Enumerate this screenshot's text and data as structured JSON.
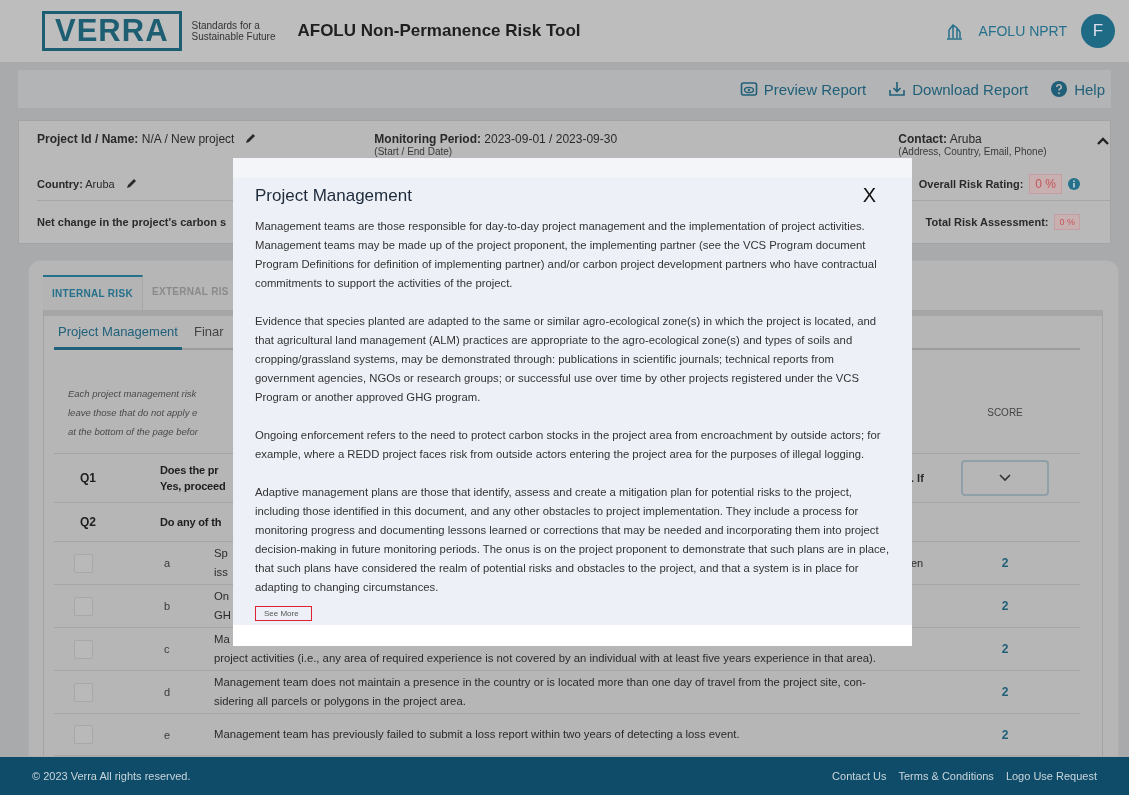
{
  "header": {
    "logo": {
      "wordmark": "VERRA",
      "tagline": [
        "Standards for a",
        "Sustainable Future"
      ]
    },
    "title": "AFOLU Non-Permanence Risk Tool",
    "app_label": "AFOLU NPRT",
    "avatar": "F"
  },
  "toolbar": [
    {
      "kind": "preview",
      "label": "Preview Report"
    },
    {
      "kind": "download",
      "label": "Download Report"
    },
    {
      "kind": "help",
      "label": "Help"
    }
  ],
  "project_info": {
    "project": {
      "label": "Project Id / Name:",
      "value": "N/A / New project",
      "editable": true
    },
    "period": {
      "label": "Monitoring Period:",
      "value": "2023-09-01 / 2023-09-30",
      "hint": "(Start / End Date)"
    },
    "contact": {
      "label": "Contact:",
      "value": "Aruba",
      "hint": "(Address, Country, Email, Phone)"
    },
    "expanded": true,
    "country": {
      "label": "Country:",
      "value": "Aruba",
      "editable": true
    },
    "overall_risk": {
      "label": "Overall Risk Rating:",
      "value": "0 %"
    },
    "net_change": {
      "label": "Net change in the project's carbon s"
    },
    "total_risk": {
      "label": "Total Risk Assessment:",
      "value": "0 %"
    }
  },
  "tabs": [
    {
      "label": "INTERNAL RISK",
      "selected": true
    },
    {
      "label": "EXTERNAL RIS",
      "selected": false
    }
  ],
  "subtabs": [
    {
      "label": "Project Management",
      "selected": true
    },
    {
      "label": "Finar",
      "selected": false
    }
  ],
  "intro_lines": [
    "Each project management risk",
    "leave those that do not apply e",
    "at the bottom of the page befor"
  ],
  "score_header": "SCORE",
  "questions": [
    {
      "kind": "dropdown",
      "number": "Q1",
      "fragments": [
        "Does the pr",
        "Yes, proceed"
      ],
      "tail": ". If"
    },
    {
      "kind": "plain",
      "number": "Q2",
      "fragments": [
        "Do any of th"
      ]
    }
  ],
  "items": [
    {
      "checked": false,
      "letter": "a",
      "fragments": [
        "Sp",
        "iss"
      ],
      "tail": "en",
      "score": "2"
    },
    {
      "checked": false,
      "letter": "b",
      "fragments": [
        "On",
        "GH"
      ],
      "score": "2"
    },
    {
      "checked": false,
      "letter": "c",
      "fragments": [
        "Ma",
        "project activities (i.e., any area of required experience is not covered by an individual with at least five years experience in that area)."
      ],
      "score": "2"
    },
    {
      "checked": false,
      "letter": "d",
      "lines": [
        "Management team does not maintain a presence in the country or is located more than one day of travel from the project site, con-",
        "sidering all parcels or polygons in the project area."
      ],
      "score": "2"
    },
    {
      "checked": false,
      "letter": "e",
      "lines": [
        "Management team has previously failed to submit a loss report within two years of detecting a loss event."
      ],
      "score": "2"
    }
  ],
  "modal": {
    "title": "Project Management",
    "close": "X",
    "paragraphs": [
      "Management teams are those responsible for day-to-day project management and the implementation of project activities. Management teams may be made up of the project proponent, the implementing partner (see the VCS Program document Program Definitions for definition of implementing partner) and/or carbon project development partners who have contractual commitments to support the activities of the project.",
      "Evidence that species planted are adapted to the same or similar agro-ecological zone(s) in which the project is located, and that agricultural land management (ALM) practices are appropriate to the agro-ecological zone(s) and types of soils and cropping/grassland systems, may be demonstrated through: publications in scientific journals; technical reports from government agencies, NGOs or research groups; or successful use over time by other projects registered under the VCS Program or another approved GHG program.",
      "Ongoing enforcement refers to the need to protect carbon stocks in the project area from encroachment by outside actors; for example, where a REDD project faces risk from outside actors entering the project area for the purposes of illegal logging.",
      "Adaptive management plans are those that identify, assess and create a mitigation plan for potential risks to the project, including those identified in this document, and any other obstacles to project implementation. They include a process for monitoring progress and documenting lessons learned or corrections that may be needed and incorporating them into project decision-making in future monitoring periods. The onus is on the project proponent to demonstrate that such plans are in place, that such plans have considered the realm of potential risks and obstacles to the project, and that a system is in place for adapting to changing circumstances."
    ],
    "see_more": "See More"
  },
  "footer": {
    "copyright": "© 2023 Verra All rights reserved.",
    "links": [
      "Contact Us",
      "Terms & Conditions",
      "Logo Use Request"
    ]
  }
}
